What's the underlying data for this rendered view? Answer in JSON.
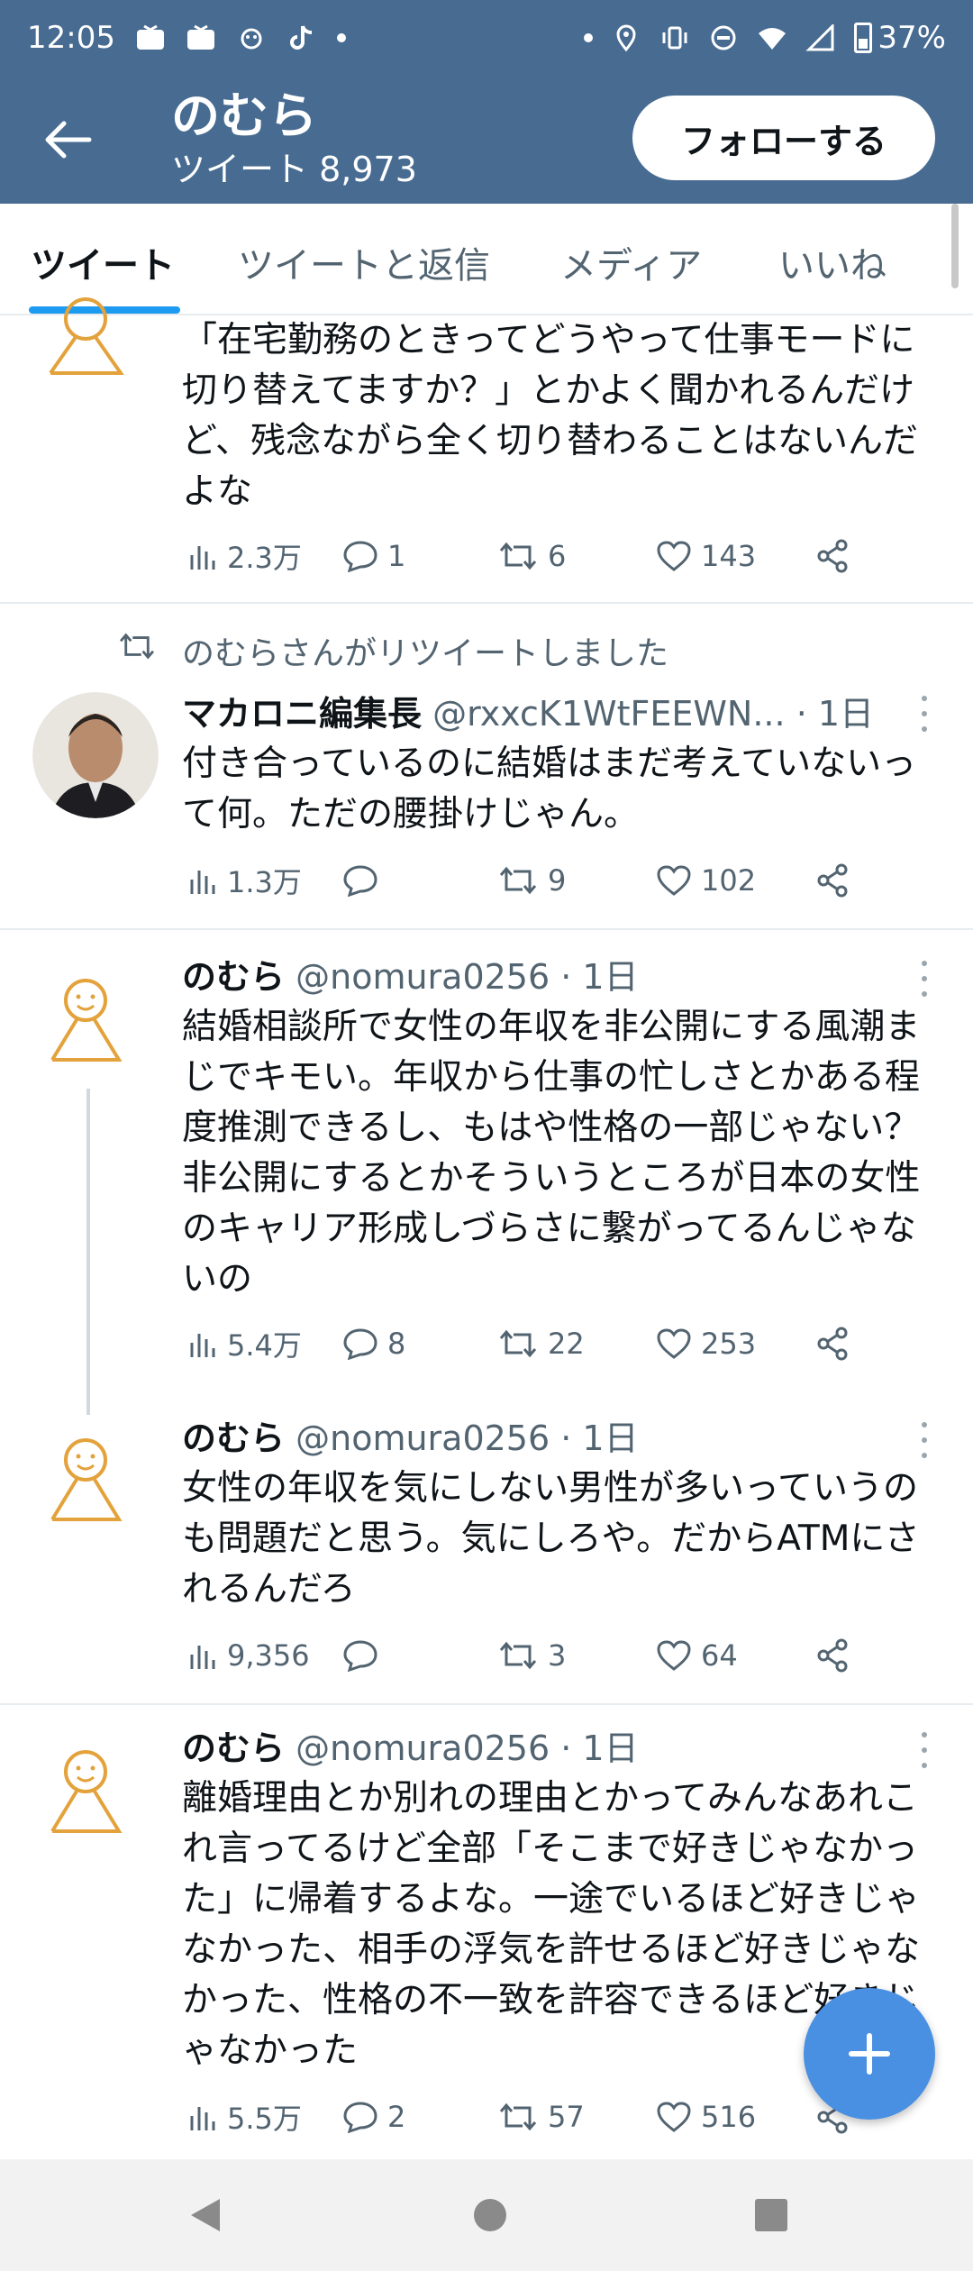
{
  "status_bar": {
    "time": "12:05",
    "battery": "37%"
  },
  "header": {
    "profile_name": "のむら",
    "tweet_count": "ツイート 8,973",
    "follow_label": "フォローする"
  },
  "tabs": [
    {
      "label": "ツイート"
    },
    {
      "label": "ツイートと返信"
    },
    {
      "label": "メディア"
    },
    {
      "label": "いいね"
    }
  ],
  "tweets": [
    {
      "name": "",
      "handle": "",
      "time": "",
      "text": "「在宅勤務のときってどうやって仕事モードに切り替えてますか？」とかよく聞かれるんだけど、残念ながら全く切り替わることはないんだよな",
      "views": "2.3万",
      "replies": "1",
      "retweets": "6",
      "likes": "143"
    },
    {
      "retweet_label": "のむらさんがリツイートしました",
      "name": "マカロニ編集長",
      "handle": "@rxxcK1WtFEEWN...",
      "time": "· 1日",
      "text": "付き合っているのに結婚はまだ考えていないって何。ただの腰掛けじゃん。",
      "views": "1.3万",
      "replies": "",
      "retweets": "9",
      "likes": "102"
    },
    {
      "name": "のむら",
      "handle": "@nomura0256",
      "time": "· 1日",
      "text": "結婚相談所で女性の年収を非公開にする風潮まじでキモい。年収から仕事の忙しさとかある程度推測できるし、もはや性格の一部じゃない？非公開にするとかそういうところが日本の女性のキャリア形成しづらさに繋がってるんじゃないの",
      "views": "5.4万",
      "replies": "8",
      "retweets": "22",
      "likes": "253"
    },
    {
      "name": "のむら",
      "handle": "@nomura0256",
      "time": "· 1日",
      "text": "女性の年収を気にしない男性が多いっていうのも問題だと思う。気にしろや。だからATMにされるんだろ",
      "views": "9,356",
      "replies": "",
      "retweets": "3",
      "likes": "64"
    },
    {
      "name": "のむら",
      "handle": "@nomura0256",
      "time": "· 1日",
      "text": "離婚理由とか別れの理由とかってみんなあれこれ言ってるけど全部「そこまで好きじゃなかった」に帰着するよな。一途でいるほど好きじゃなかった、相手の浮気を許せるほど好きじゃなかった、性格の不一致を許容できるほど好きじゃなかった",
      "views": "5.5万",
      "replies": "2",
      "retweets": "57",
      "likes": "516"
    }
  ],
  "colors": {
    "header_bg": "#476b91",
    "accent": "#1d9bf0",
    "fab": "#4a90e2",
    "avatar_sketch": "#e3a23b"
  },
  "icons": [
    "back-arrow-icon",
    "views-icon",
    "reply-icon",
    "retweet-icon",
    "like-icon",
    "share-icon",
    "compose-plus-icon"
  ]
}
